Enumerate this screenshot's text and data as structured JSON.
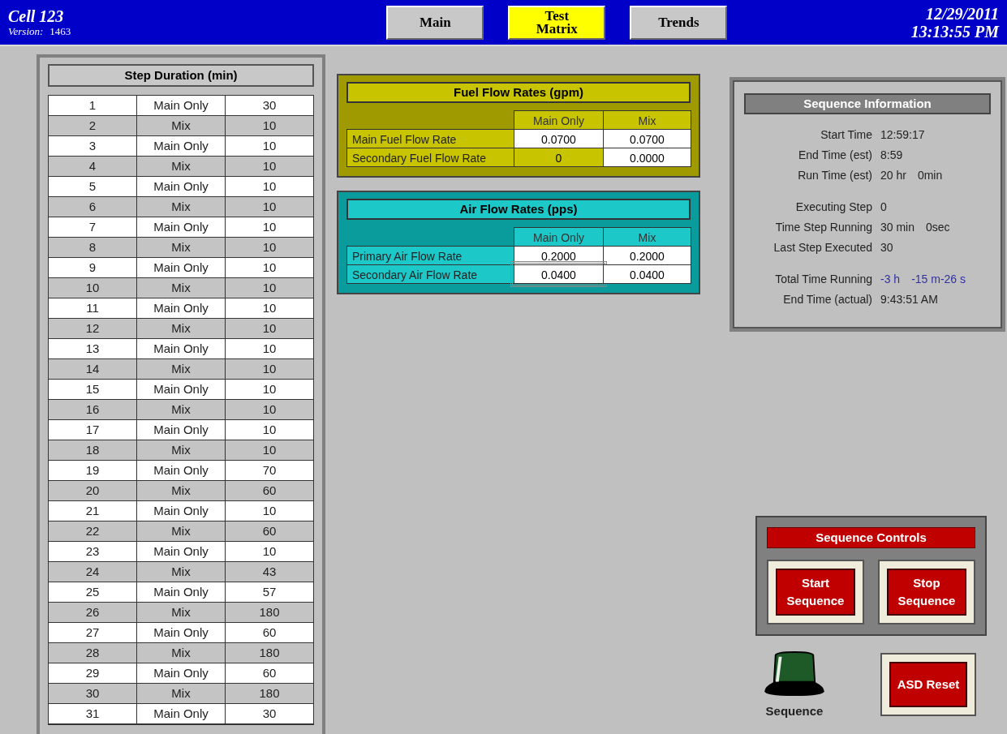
{
  "header": {
    "cell": "Cell 123",
    "version_label": "Version:",
    "version": "1463",
    "date": "12/29/2011",
    "time": "13:13:55 PM"
  },
  "tabs": [
    {
      "label": "Main",
      "selected": false
    },
    {
      "label": "Test Matrix",
      "selected": true
    },
    {
      "label": "Trends",
      "selected": false
    }
  ],
  "steps": {
    "title": "Step Duration (min)",
    "rows": [
      {
        "step": "1",
        "mode": "Main Only",
        "minutes": "30"
      },
      {
        "step": "2",
        "mode": "Mix",
        "minutes": "10"
      },
      {
        "step": "3",
        "mode": "Main Only",
        "minutes": "10"
      },
      {
        "step": "4",
        "mode": "Mix",
        "minutes": "10"
      },
      {
        "step": "5",
        "mode": "Main Only",
        "minutes": "10"
      },
      {
        "step": "6",
        "mode": "Mix",
        "minutes": "10"
      },
      {
        "step": "7",
        "mode": "Main Only",
        "minutes": "10"
      },
      {
        "step": "8",
        "mode": "Mix",
        "minutes": "10"
      },
      {
        "step": "9",
        "mode": "Main Only",
        "minutes": "10"
      },
      {
        "step": "10",
        "mode": "Mix",
        "minutes": "10"
      },
      {
        "step": "11",
        "mode": "Main Only",
        "minutes": "10"
      },
      {
        "step": "12",
        "mode": "Mix",
        "minutes": "10"
      },
      {
        "step": "13",
        "mode": "Main Only",
        "minutes": "10"
      },
      {
        "step": "14",
        "mode": "Mix",
        "minutes": "10"
      },
      {
        "step": "15",
        "mode": "Main Only",
        "minutes": "10"
      },
      {
        "step": "16",
        "mode": "Mix",
        "minutes": "10"
      },
      {
        "step": "17",
        "mode": "Main Only",
        "minutes": "10"
      },
      {
        "step": "18",
        "mode": "Mix",
        "minutes": "10"
      },
      {
        "step": "19",
        "mode": "Main Only",
        "minutes": "70"
      },
      {
        "step": "20",
        "mode": "Mix",
        "minutes": "60"
      },
      {
        "step": "21",
        "mode": "Main Only",
        "minutes": "10"
      },
      {
        "step": "22",
        "mode": "Mix",
        "minutes": "60"
      },
      {
        "step": "23",
        "mode": "Main Only",
        "minutes": "10"
      },
      {
        "step": "24",
        "mode": "Mix",
        "minutes": "43"
      },
      {
        "step": "25",
        "mode": "Main Only",
        "minutes": "57"
      },
      {
        "step": "26",
        "mode": "Mix",
        "minutes": "180"
      },
      {
        "step": "27",
        "mode": "Main Only",
        "minutes": "60"
      },
      {
        "step": "28",
        "mode": "Mix",
        "minutes": "180"
      },
      {
        "step": "29",
        "mode": "Main Only",
        "minutes": "60"
      },
      {
        "step": "30",
        "mode": "Mix",
        "minutes": "180"
      },
      {
        "step": "31",
        "mode": "Main Only",
        "minutes": "30"
      }
    ]
  },
  "rate_panels": [
    {
      "kind": "fuel",
      "title": "Fuel Flow Rates (gpm)",
      "columns": [
        "Main Only",
        "Mix"
      ],
      "rows": [
        {
          "label": "Main Fuel Flow Rate",
          "cells": [
            {
              "value": "0.0700",
              "editable": true,
              "focused": false
            },
            {
              "value": "0.0700",
              "editable": true,
              "focused": false
            }
          ]
        },
        {
          "label": "Secondary Fuel Flow Rate",
          "cells": [
            {
              "value": "0",
              "editable": false,
              "focused": false
            },
            {
              "value": "0.0000",
              "editable": true,
              "focused": false
            }
          ]
        }
      ]
    },
    {
      "kind": "air",
      "title": "Air Flow Rates (pps)",
      "columns": [
        "Main Only",
        "Mix"
      ],
      "rows": [
        {
          "label": "Primary Air Flow Rate",
          "cells": [
            {
              "value": "0.2000",
              "editable": true,
              "focused": false
            },
            {
              "value": "0.2000",
              "editable": true,
              "focused": false
            }
          ]
        },
        {
          "label": "Secondary Air Flow Rate",
          "cells": [
            {
              "value": "0.0400",
              "editable": true,
              "focused": true
            },
            {
              "value": "0.0400",
              "editable": true,
              "focused": false
            }
          ]
        }
      ]
    }
  ],
  "sequence_info": {
    "title": "Sequence Information",
    "groups": [
      [
        {
          "label": "Start Time",
          "values": [
            "12:59:17"
          ]
        },
        {
          "label": "End Time (est)",
          "values": [
            "8:59"
          ]
        },
        {
          "label": "Run Time (est)",
          "values": [
            "20 hr",
            "0min"
          ]
        }
      ],
      [
        {
          "label": "Executing Step",
          "values": [
            "0"
          ]
        },
        {
          "label": "Time Step Running",
          "values": [
            "30 min",
            "0sec"
          ]
        },
        {
          "label": "Last Step Executed",
          "values": [
            "30"
          ]
        }
      ],
      [
        {
          "label": "Total Time Running",
          "values": [
            "-3 h",
            "-15 m-26 s"
          ],
          "color": "#3030a0"
        },
        {
          "label": "End Time (actual)",
          "values": [
            "9:43:51 AM"
          ]
        }
      ]
    ]
  },
  "sequence_controls": {
    "title": "Sequence Controls",
    "buttons": [
      "Start Sequence",
      "Stop Sequence"
    ]
  },
  "lamp_label": "Sequence",
  "reset_button": "ASD Reset"
}
